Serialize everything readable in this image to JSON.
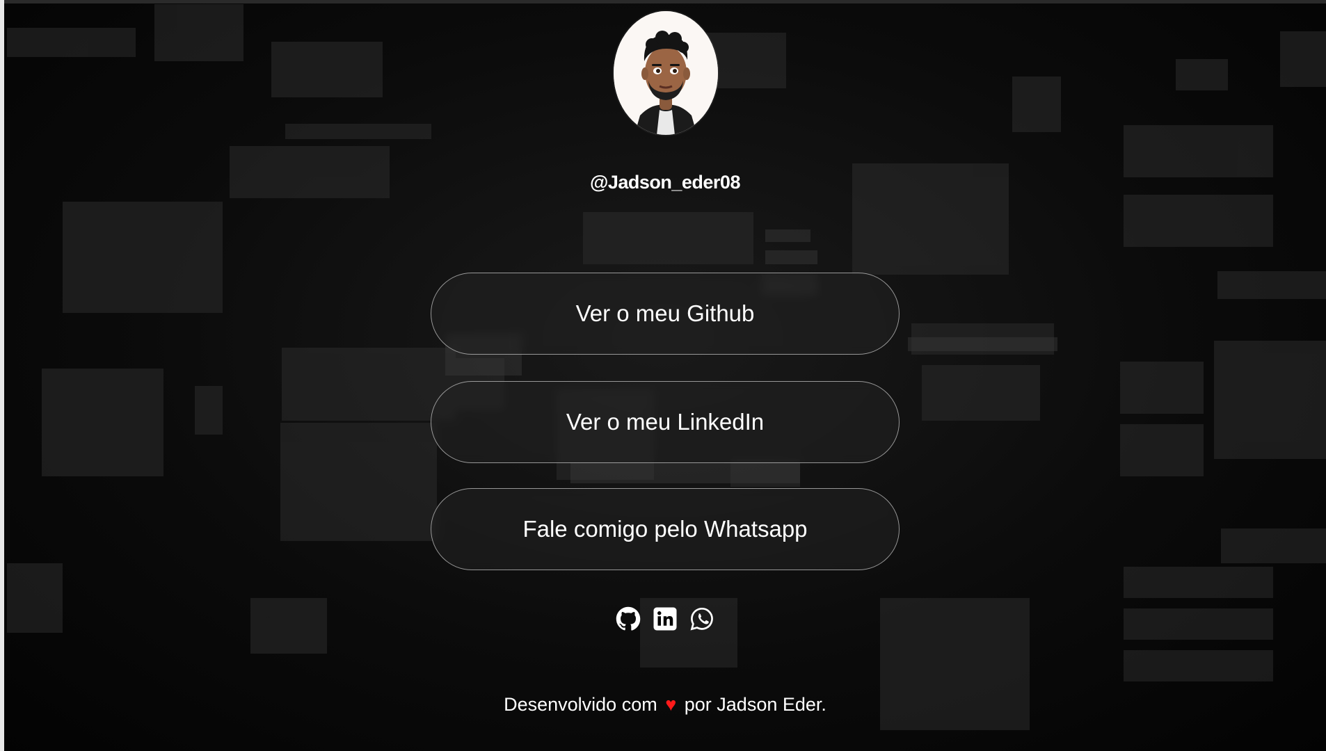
{
  "profile": {
    "username": "@Jadson_eder08",
    "avatar_alt": "avatar"
  },
  "links": [
    {
      "label": "Ver o meu Github"
    },
    {
      "label": "Ver o meu LinkedIn"
    },
    {
      "label": "Fale comigo pelo Whatsapp"
    }
  ],
  "social_icons": [
    {
      "icon": "github-icon"
    },
    {
      "icon": "linkedin-icon"
    },
    {
      "icon": "whatsapp-icon"
    }
  ],
  "footer": {
    "prefix": "Desenvolvido com",
    "heart": "♥",
    "suffix": "por Jadson Eder."
  },
  "colors": {
    "background": "#050505",
    "button_border": "#d9d9d9",
    "text": "#ffffff",
    "heart": "#ff1a1a"
  }
}
